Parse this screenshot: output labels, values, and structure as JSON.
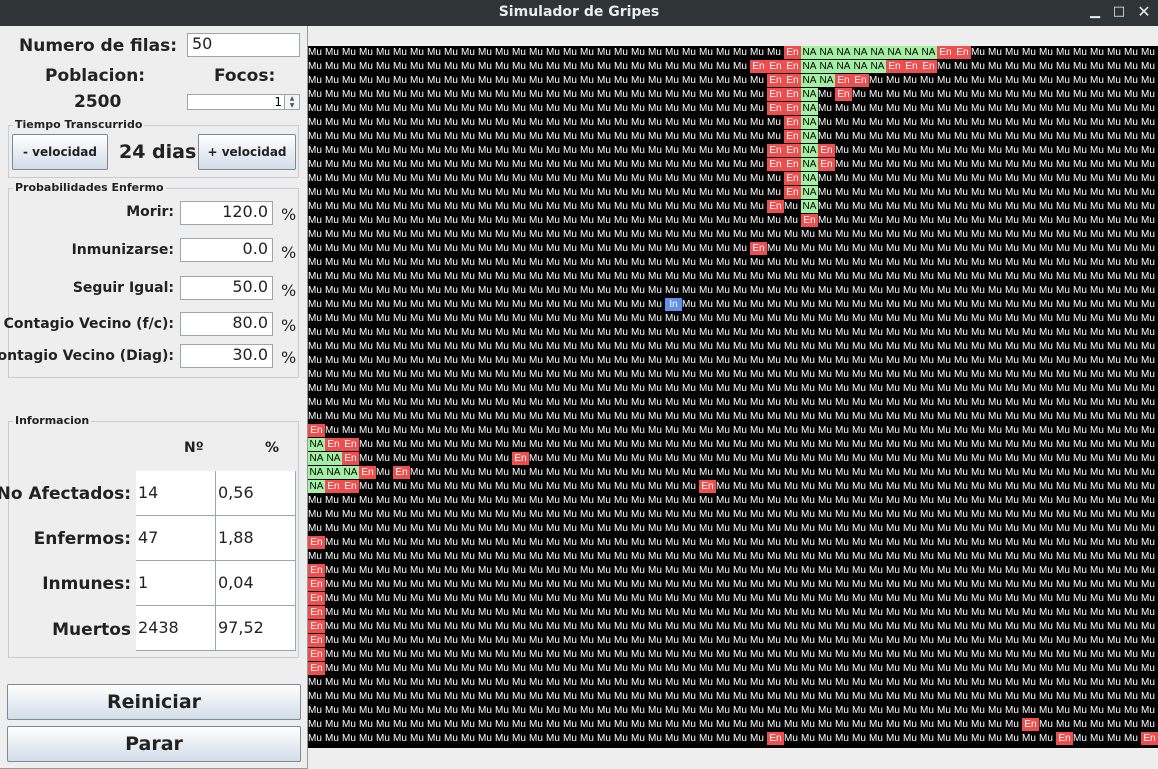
{
  "window": {
    "title": "Simulador de Gripes"
  },
  "top": {
    "rows_label": "Numero de filas:",
    "rows_value": "50",
    "population_label": "Poblacion:",
    "population_value": "2500",
    "foci_label": "Focos:",
    "foci_value": "1"
  },
  "time": {
    "legend": "Tiempo Transcurrido",
    "slower_label": "- velocidad",
    "elapsed": "24 dias",
    "faster_label": "+ velocidad"
  },
  "probabilities": {
    "legend": "Probabilidades Enfermo",
    "die_label": "Morir:",
    "die_value": "120.0",
    "immunize_label": "Inmunizarse:",
    "immunize_value": "0.0",
    "same_label": "Seguir Igual:",
    "same_value": "50.0",
    "neighbor_label": "Contagio Vecino (f/c):",
    "neighbor_value": "80.0",
    "diag_label": "Contagio Vecino (Diag):",
    "diag_value": "30.0",
    "percent": "%"
  },
  "info": {
    "legend": "Informacion",
    "col_n": "Nº",
    "col_pct": "%",
    "rows": [
      {
        "label": "No Afectados:",
        "n": "14",
        "pct": "0,56"
      },
      {
        "label": "Enfermos:",
        "n": "47",
        "pct": "1,88"
      },
      {
        "label": "Inmunes:",
        "n": "1",
        "pct": "0,04"
      },
      {
        "label": "Muertos",
        "n": "2438",
        "pct": "97,52"
      }
    ]
  },
  "buttons": {
    "restart": "Reiniciar",
    "stop": "Parar"
  },
  "colors": {
    "sick": "#ef4e4e",
    "unaffected": "#a3efa3",
    "immune": "#5f8fe6",
    "dead_bg": "#000000"
  },
  "grid_legend": {
    "Mu": "muerto",
    "En": "enfermo",
    "NA": "no afectado",
    "In": "inmune"
  },
  "grid": {
    "rows": [
      "MuMuMuMuMuMuMuMuMuMuMuMuMuMuMuMuMuMuMuMuMuMuMuMuMuMuMuMuEnNANANANANANANANAEnEnMuMuMuMuMuMuMuMuMuMuMu",
      "MuMuMuMuMuMuMuMuMuMuMuMuMuMuMuMuMuMuMuMuMuMuMuMuMuMuEnEnEnNANANANANAEnEnEnMuMuMuMuMuMuMuMuMuMuMuMuMuMu",
      "MuMuMuMuMuMuMuMuMuMuMuMuMuMuMuMuMuMuMuMuMuMuMuMuMuMuMuEnEnNANAEnEnMuMuMuMuMuMuMuMuMuMuMuMuMuMuMuMuMuMuMu",
      "MuMuMuMuMuMuMuMuMuMuMuMuMuMuMuMuMuMuMuMuMuMuMuMuMuMuMuEnEnNAMuEnMuMuMuMuMuMuMuMuMuMuMuMuMuMuMuMuMuMuMuMu",
      "MuMuMuMuMuMuMuMuMuMuMuMuMuMuMuMuMuMuMuMuMuMuMuMuMuMuMuEnEnNAMuMuMuMuMuMuMuMuMuMuMuMuMuMuMuMuMuMuMuMuMuMu",
      "MuMuMuMuMuMuMuMuMuMuMuMuMuMuMuMuMuMuMuMuMuMuMuMuMuMuMuMuEnNAMuMuMuMuMuMuMuMuMuMuMuMuMuMuMuMuMuMuMuMuMuMu",
      "MuMuMuMuMuMuMuMuMuMuMuMuMuMuMuMuMuMuMuMuMuMuMuMuMuMuMuMuEnNAMuMuMuMuMuMuMuMuMuMuMuMuMuMuMuMuMuMuMuMuMuMu",
      "MuMuMuMuMuMuMuMuMuMuMuMuMuMuMuMuMuMuMuMuMuMuMuMuMuMuMuEnEnNAEnMuMuMuMuMuMuMuMuMuMuMuMuMuMuMuMuMuMuMuMuMu",
      "MuMuMuMuMuMuMuMuMuMuMuMuMuMuMuMuMuMuMuMuMuMuMuMuMuMuMuEnEnNAEnMuMuMuMuMuMuMuMuMuMuMuMuMuMuMuMuMuMuMuMuMu",
      "MuMuMuMuMuMuMuMuMuMuMuMuMuMuMuMuMuMuMuMuMuMuMuMuMuMuMuMuEnNAMuMuMuMuMuMuMuMuMuMuMuMuMuMuMuMuMuMuMuMuMuMu",
      "MuMuMuMuMuMuMuMuMuMuMuMuMuMuMuMuMuMuMuMuMuMuMuMuMuMuMuMuEnNAMuMuMuMuMuMuMuMuMuMuMuMuMuMuMuMuMuMuMuMuMuMu",
      "MuMuMuMuMuMuMuMuMuMuMuMuMuMuMuMuMuMuMuMuMuMuMuMuMuMuMuEnMuNAMuMuMuMuMuMuMuMuMuMuMuMuMuMuMuMuMuMuMuMuMuMu",
      "MuMuMuMuMuMuMuMuMuMuMuMuMuMuMuMuMuMuMuMuMuMuMuMuMuMuMuMuMuEnMuMuMuMuMuMuMuMuMuMuMuMuMuMuMuMuMuMuMuMuMuMu",
      "MuMuMuMuMuMuMuMuMuMuMuMuMuMuMuMuMuMuMuMuMuMuMuMuMuMuMuMuMuMuMuMuMuMuMuMuMuMuMuMuMuMuMuMuMuMuMuMuMuMu",
      "MuMuMuMuMuMuMuMuMuMuMuMuMuMuMuMuMuMuMuMuMuMuMuMuMuMuEnMuMuMuMuMuMuMuMuMuMuMuMuMuMuMuMuMuMuMuMuMuMuMu",
      "MuMuMuMuMuMuMuMuMuMuMuMuMuMuMuMuMuMuMuMuMuMuMuMuMuMuMuMuMuMuMuMuMuMuMuMuMuMuMuMuMuMuMuMuMuMuMuMuMuMu",
      "MuMuMuMuMuMuMuMuMuMuMuMuMuMuMuMuMuMuMuMuMuMuMuMuMuMuMuMuMuMuMuMuMuMuMuMuMuMuMuMuMuMuMuMuMuMuMuMuMuMu",
      "MuMuMuMuMuMuMuMuMuMuMuMuMuMuMuMuMuMuMuMuMuMuMuMuMuMuMuMuMuMuMuMuMuMuMuMuMuMuMuMuMuMuMuMuMuMuMuMuMuMu",
      "MuMuMuMuMuMuMuMuMuMuMuMuMuMuMuMuMuMuMuMuMuInMuMuMuMuMuMuMuMuMuMuMuMuMuMuMuMuMuMuMuMuMuMuMuMuMuMuMuMu",
      "MuMuMuMuMuMuMuMuMuMuMuMuMuMuMuMuMuMuMuMuMuMuMuMuMuMuMuMuMuMuMuMuMuMuMuMuMuMuMuMuMuMuMuMuMuMuMuMuMuMu",
      "MuMuMuMuMuMuMuMuMuMuMuMuMuMuMuMuMuMuMuMuMuMuMuMuMuMuMuMuMuMuMuMuMuMuMuMuMuMuMuMuMuMuMuMuMuMuMuMuMuMu",
      "MuMuMuMuMuMuMuMuMuMuMuMuMuMuMuMuMuMuMuMuMuMuMuMuMuMuMuMuMuMuMuMuMuMuMuMuMuMuMuMuMuMuMuMuMuMuMuMuMuMu",
      "MuMuMuMuMuMuMuMuMuMuMuMuMuMuMuMuMuMuMuMuMuMuMuMuMuMuMuMuMuMuMuMuMuMuMuMuMuMuMuMuMuMuMuMuMuMuMuMuMuMu",
      "MuMuMuMuMuMuMuMuMuMuMuMuMuMuMuMuMuMuMuMuMuMuMuMuMuMuMuMuMuMuMuMuMuMuMuMuMuMuMuMuMuMuMuMuMuMuMuMuMuMu",
      "MuMuMuMuMuMuMuMuMuMuMuMuMuMuMuMuMuMuMuMuMuMuMuMuMuMuMuMuMuMuMuMuMuMuMuMuMuMuMuMuMuMuMuMuMuMuMuMuMuMu",
      "MuMuMuMuMuMuMuMuMuMuMuMuMuMuMuMuMuMuMuMuMuMuMuMuMuMuMuMuMuMuMuMuMuMuMuMuMuMuMuMuMuMuMuMuMuMuMuMuMuMu",
      "MuMuMuMuMuMuMuMuMuMuMuMuMuMuMuMuMuMuMuMuMuMuMuMuMuMuMuMuMuMuMuMuMuMuMuMuMuMuMuMuMuMuMuMuMuMuMuMuMuMu",
      "EnMuMuMuMuMuMuMuMuMuMuMuMuMuMuMuMuMuMuMuMuMuMuMuMuMuMuMuMuMuMuMuMuMuMuMuMuMuMuMuMuMuMuMuMuMuMuMuMuMu",
      "NAEnEnMuMuMuMuMuMuMuMuMuMuMuMuMuMuMuMuMuMuMuMuMuMuMuMuMuMuMuMuMuMuMuMuMuMuMuMuMuMuMuMuMuMuMuMuMuMuMu",
      "NANAEnMuMuMuMuMuMuMuMuMuEnMuMuMuMuMuMuMuMuMuMuMuMuMuMuMuMuMuMuMuMuMuMuMuMuMuMuMuMuMuMuMuMuMuMuMuMuMu",
      "NANANAEnMuEnMuMuMuMuMuMuMuMuMuMuMuMuMuMuMuMuMuMuMuMuMuMuMuMuMuMuMuMuMuMuMuMuMuMuMuMuMuMuMuMuMuMuMuMu",
      "NAEnEnMuMuMuMuMuMuMuMuMuMuMuMuMuMuMuMuMuMuMuMuEnMuMuMuMuMuMuMuMuMuMuMuMuMuMuMuMuMuMuMuMuMuMuMuMuMuMu",
      "MuMuMuMuMuMuMuMuMuMuMuMuMuMuMuMuMuMuMuMuMuMuMuMuMuMuMuMuMuMuMuMuMuMuMuMuMuMuMuMuMuMuMuMuMuMuMuMuMuMu",
      "MuMuMuMuMuMuMuMuMuMuMuMuMuMuMuMuMuMuMuMuMuMuMuMuMuMuMuMuMuMuMuMuMuMuMuMuMuMuMuMuMuMuMuMuMuMuMuMuMuMu",
      "MuMuMuMuMuMuMuMuMuMuMuMuMuMuMuMuMuMuMuMuMuMuMuMuMuMuMuMuMuMuMuMuMuMuMuMuMuMuMuMuMuMuMuMuMuMuMuMuMuMu",
      "EnMuMuMuMuMuMuMuMuMuMuMuMuMuMuMuMuMuMuMuMuMuMuMuMuMuMuMuMuMuMuMuMuMuMuMuMuMuMuMuMuMuMuMuMuMuMuMuMuMu",
      "MuMuMuMuMuMuMuMuMuMuMuMuMuMuMuMuMuMuMuMuMuMuMuMuMuMuMuMuMuMuMuMuMuMuMuMuMuMuMuMuMuMuMuMuMuMuMuMuMuMu",
      "EnMuMuMuMuMuMuMuMuMuMuMuMuMuMuMuMuMuMuMuMuMuMuMuMuMuMuMuMuMuMuMuMuMuMuMuMuMuMuMuMuMuMuMuMuMuMuMuMuMu",
      "EnMuMuMuMuMuMuMuMuMuMuMuMuMuMuMuMuMuMuMuMuMuMuMuMuMuMuMuMuMuMuMuMuMuMuMuMuMuMuMuMuMuMuMuMuMuMuMuMuMu",
      "EnMuMuMuMuMuMuMuMuMuMuMuMuMuMuMuMuMuMuMuMuMuMuMuMuMuMuMuMuMuMuMuMuMuMuMuMuMuMuMuMuMuMuMuMuMuMuMuMuMu",
      "EnMuMuMuMuMuMuMuMuMuMuMuMuMuMuMuMuMuMuMuMuMuMuMuMuMuMuMuMuMuMuMuMuMuMuMuMuMuMuMuMuMuMuMuMuMuMuMuMuMu",
      "EnMuMuMuMuMuMuMuMuMuMuMuMuMuMuMuMuMuMuMuMuMuMuMuMuMuMuMuMuMuMuMuMuMuMuMuMuMuMuMuMuMuMuMuMuMuMuMuMuMu",
      "EnMuMuMuMuMuMuMuMuMuMuMuMuMuMuMuMuMuMuMuMuMuMuMuMuMuMuMuMuMuMuMuMuMuMuMuMuMuMuMuMuMuMuMuMuMuMuMuMuMu",
      "EnMuMuMuMuMuMuMuMuMuMuMuMuMuMuMuMuMuMuMuMuMuMuMuMuMuMuMuMuMuMuMuMuMuMuMuMuMuMuMuMuMuMuMuMuMuMuMuMuMu",
      "EnMuMuMuMuMuMuMuMuMuMuMuMuMuMuMuMuMuMuMuMuMuMuMuMuMuMuMuMuMuMuMuMuMuMuMuMuMuMuMuMuMuMuMuMuMuMuMuMuMu",
      "MuMuMuMuMuMuMuMuMuMuMuMuMuMuMuMuMuMuMuMuMuMuMuMuMuMuMuMuMuMuMuMuMuMuMuMuMuMuMuMuMuMuMuMuMuMuMuMuMuMu",
      "MuMuMuMuMuMuMuMuMuMuMuMuMuMuMuMuMuMuMuMuMuMuMuMuMuMuMuMuMuMuMuMuMuMuMuMuMuMuMuMuMuMuMuMuMuMuMuMuMuMu",
      "MuMuMuMuMuMuMuMuMuMuMuMuMuMuMuMuMuMuMuMuMuMuMuMuMuMuMuMuMuMuMuMuMuMuMuMuMuMuMuMuMuMuMuMuMuMuMuMuMuMu",
      "MuMuMuMuMuMuMuMuMuMuMuMuMuMuMuMuMuMuMuMuMuMuMuMuMuMuMuMuMuMuMuMuMuMuMuMuMuMuMuMuMuMuEnMuMuMuMuMuMuMu",
      "MuMuMuMuMuMuMuMuMuMuMuMuMuMuMuMuMuMuMuMuMuMuMuMuMuMuMuEnMuMuMuMuMuMuMuMuMuMuMuMuMuMuMuMuEnMuMuMuMuEn"
    ]
  }
}
